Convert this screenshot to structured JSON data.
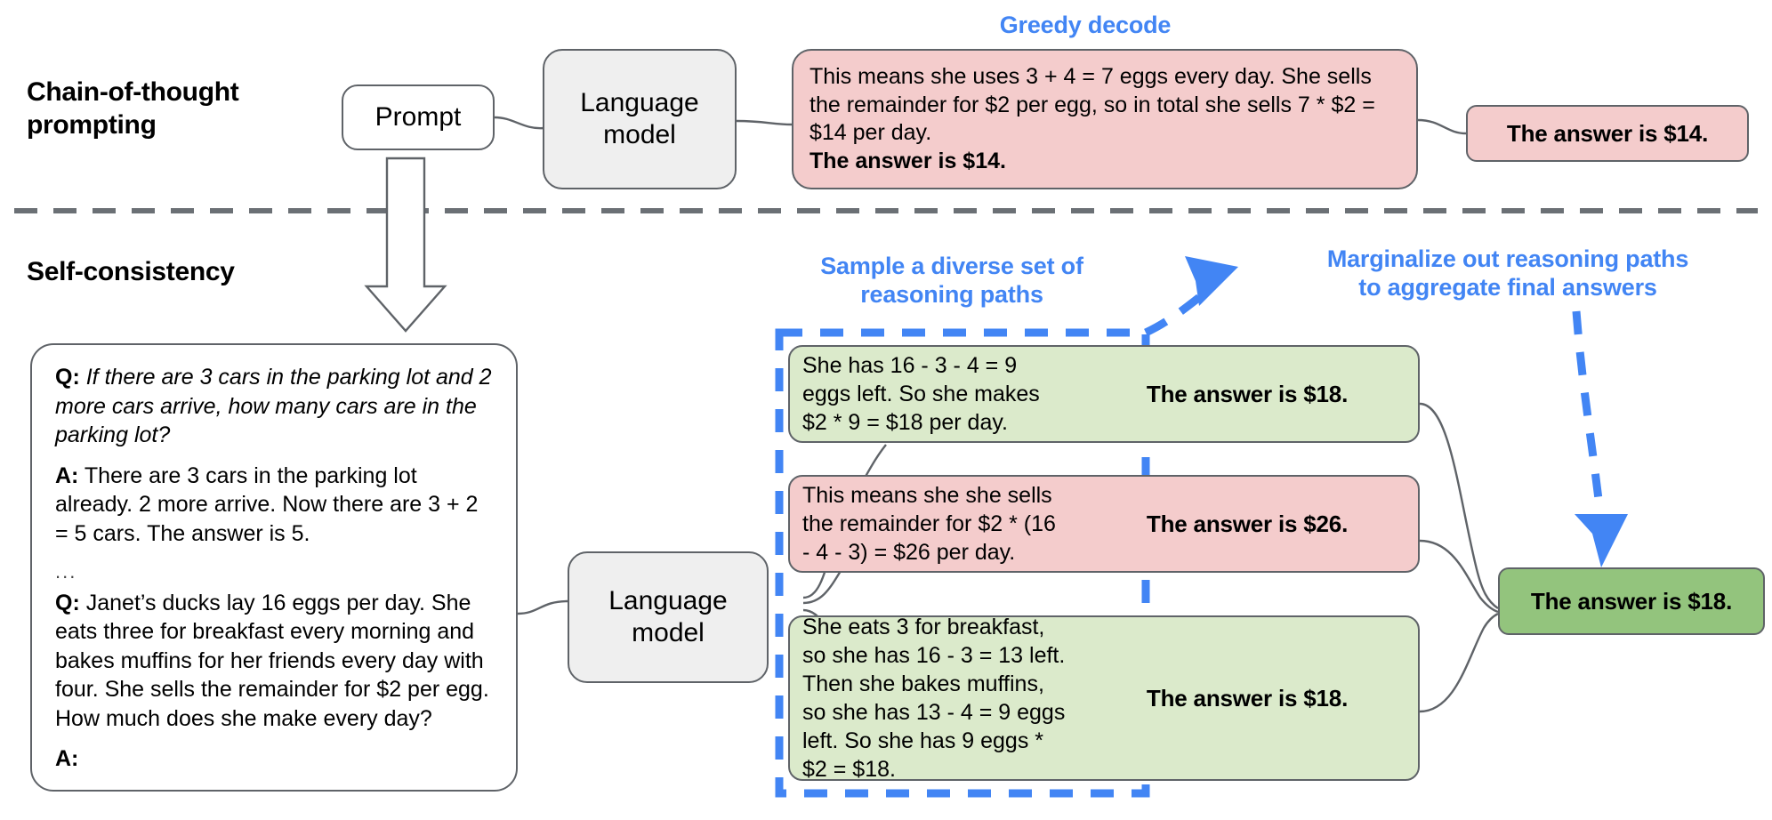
{
  "sections": {
    "cot": {
      "title": "Chain-of-thought prompting"
    },
    "sc": {
      "title": "Self-consistency"
    }
  },
  "labels": {
    "greedy_decode": "Greedy decode",
    "sample_paths_line1": "Sample a diverse set of",
    "sample_paths_line2": "reasoning paths",
    "marginalize_line1": "Marginalize out reasoning paths",
    "marginalize_line2": "to aggregate final answers"
  },
  "nodes": {
    "prompt": "Prompt",
    "lm_top_line1": "Language",
    "lm_top_line2": "model",
    "lm_bottom_line1": "Language",
    "lm_bottom_line2": "model"
  },
  "cot_output": {
    "body": "This means she uses 3 + 4 = 7 eggs every day. She sells the remainder for $2 per egg, so in total she sells 7 * $2 = $14 per day.",
    "bold_tail": "The answer is $14.",
    "final_answer": "The answer is $14.",
    "color": "#f4cccc"
  },
  "prompt_box": {
    "q1_label": "Q:",
    "q1_text": "If there are 3 cars in the parking lot and 2 more cars arrive, how many cars are in the parking lot?",
    "a1_label": "A:",
    "a1_text": "There are 3 cars in the parking lot already. 2 more arrive. Now there are 3 + 2 = 5 cars. The answer is 5.",
    "ellipsis": "...",
    "q2_label": "Q:",
    "q2_text": "Janet’s ducks lay 16 eggs per day. She eats three for breakfast every morning and bakes muffins for her friends every day with four. She sells the remainder for $2 per egg. How much does she make every day?",
    "a2_label": "A:"
  },
  "reasoning_paths": [
    {
      "text": "She has 16 - 3 - 4 = 9 eggs left. So she makes $2 * 9 = $18 per day.",
      "answer": "The answer is $18.",
      "color": "#dbeacb"
    },
    {
      "text": "This means she she sells the remainder for $2 * (16 - 4 - 3) = $26 per day.",
      "answer": "The answer is $26.",
      "color": "#f4cccc"
    },
    {
      "text": "She eats 3 for breakfast, so she has 16 - 3 = 13 left. Then she bakes muffins, so she has 13 - 4 = 9 eggs left. So she has 9 eggs * $2 = $18.",
      "answer": "The answer is $18.",
      "color": "#dbeacb"
    }
  ],
  "final_answer": {
    "text": "The answer is $18.",
    "color": "#93c47d"
  },
  "colors": {
    "accent_blue": "#4285f4",
    "pink": "#f4cccc",
    "light_green": "#dbeacb",
    "dark_green": "#93c47d",
    "grey_box": "#efefef",
    "outline": "#5f6368"
  }
}
